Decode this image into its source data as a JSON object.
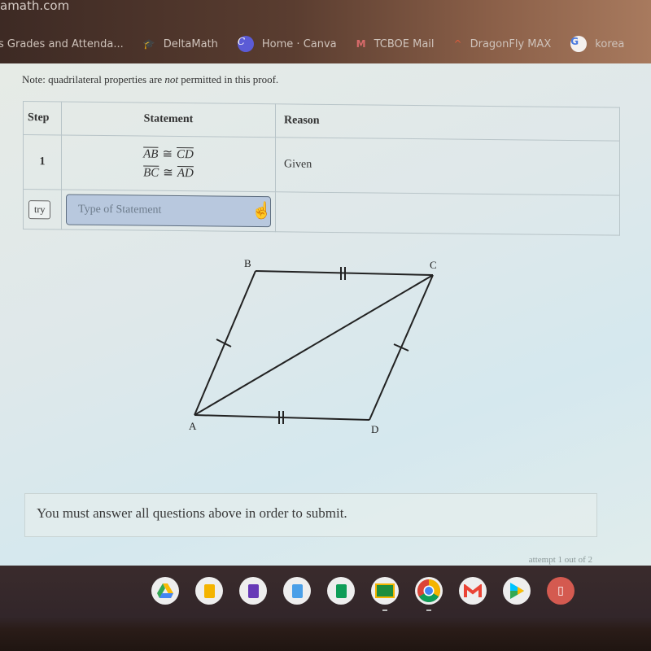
{
  "browser": {
    "url_domain": "amath.com",
    "bookmarks": [
      {
        "label": "s  Grades and Attenda...",
        "icon": "none"
      },
      {
        "label": "DeltaMath",
        "icon": "graduation-cap-icon"
      },
      {
        "label": "Home · Canva",
        "icon": "canvas-icon"
      },
      {
        "label": "TCBOE Mail",
        "icon": "gmail-icon"
      },
      {
        "label": "DragonFly MAX",
        "icon": "dragonfly-icon"
      },
      {
        "label": "korea",
        "icon": "google-icon"
      }
    ],
    "icon_glyphs": {
      "cap": "🎓",
      "canvas": "C",
      "gmail": "M",
      "dragonfly": "^",
      "google": "G"
    }
  },
  "problem": {
    "note_prefix": "Note: quadrilateral properties are ",
    "note_emphasis": "not",
    "note_suffix": " permitted in this proof.",
    "table": {
      "headers": {
        "step": "Step",
        "statement": "Statement",
        "reason": "Reason"
      },
      "rows": [
        {
          "step": "1",
          "statements": [
            {
              "left": "AB",
              "op": "≅",
              "right": "CD"
            },
            {
              "left": "BC",
              "op": "≅",
              "right": "AD"
            }
          ],
          "reason": "Given"
        }
      ],
      "input_row": {
        "try_label": "try",
        "statement_placeholder": "Type of Statement",
        "reason": ""
      }
    },
    "figure": {
      "vertices": [
        "A",
        "B",
        "C",
        "D"
      ],
      "segments": [
        "AB",
        "BC",
        "CD",
        "DA",
        "AC"
      ],
      "tick_marks": {
        "AB": 1,
        "CD": 1,
        "BC": 2,
        "AD": 2
      }
    },
    "submit_message": "You must answer all questions above in order to submit.",
    "attempt_text": "attempt 1 out of 2"
  },
  "shelf": {
    "apps": [
      {
        "name": "google-drive",
        "color": "#34a853"
      },
      {
        "name": "google-slides",
        "color": "#f4b400"
      },
      {
        "name": "google-forms",
        "color": "#673ab7"
      },
      {
        "name": "google-docs",
        "color": "#4285f4"
      },
      {
        "name": "google-sheets",
        "color": "#0f9d58"
      },
      {
        "name": "google-classroom",
        "color": "#1e8e3e"
      },
      {
        "name": "chrome",
        "color": "#4285f4"
      },
      {
        "name": "gmail",
        "color": "#ea4335"
      },
      {
        "name": "play-store",
        "color": "#00c4ff"
      },
      {
        "name": "unknown-app",
        "color": "#d45a50"
      }
    ]
  }
}
